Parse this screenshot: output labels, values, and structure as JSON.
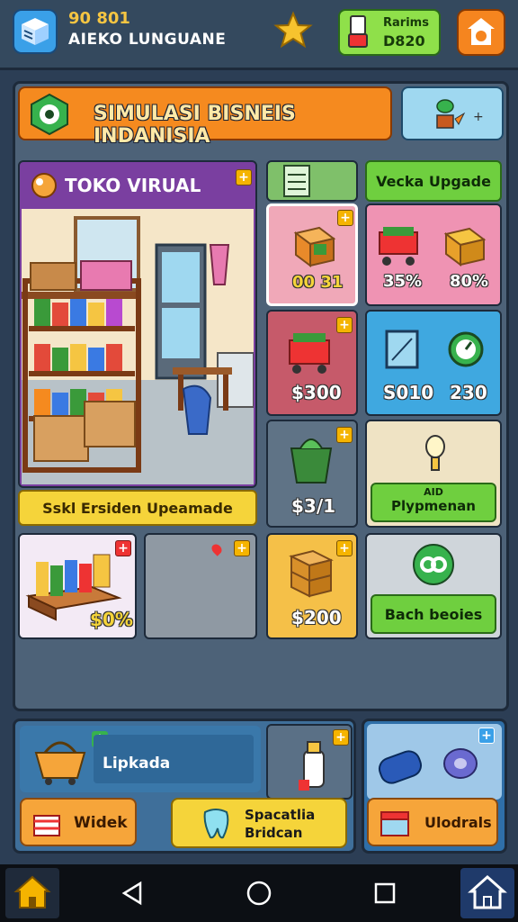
{
  "top_bar": {
    "coins": "90 801",
    "player_name": "AIEKO LUNGUANE",
    "resource_label": "Rarims",
    "resource_value": "D820"
  },
  "banner": {
    "title": "SIMULASI BISNEIS INDANISIA",
    "side_icon": "plant-growth-icon"
  },
  "store": {
    "title": "TOKO VIRUAL",
    "footer_label": "Sskl Ersiden Upeamade"
  },
  "side_header": {
    "upgrade_label": "Vecka Upgade"
  },
  "items": {
    "crate_price": "00 31",
    "cart_pct": "35%",
    "box_pct": "80%",
    "basket_price": "$300",
    "tablet_value": "S010",
    "timer_value": "230",
    "bag_price": "$3/1",
    "bulb_caption_small": "AID",
    "bulb_caption": "Plypmenan",
    "stall_pct": "$0%",
    "boxes_price": "$200",
    "link_button": "Bach beoies"
  },
  "bottom": {
    "basket_label": "Lipkada",
    "btn_widek": "Widek",
    "btn_spacatlia_line1": "Spacatlia",
    "btn_spacatlia_line2": "Bridcan",
    "btn_ulodals": "Ulodrals"
  },
  "colors": {
    "background": "#2c3e55",
    "banner_orange": "#f58a1f",
    "store_purple": "#7a3fa0",
    "accent_green": "#6fcf3f",
    "accent_yellow": "#f5d43a"
  }
}
